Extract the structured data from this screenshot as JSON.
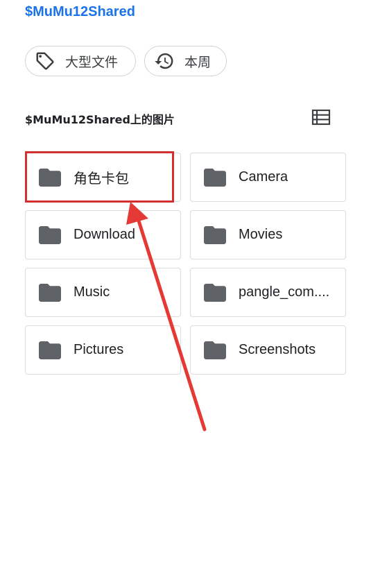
{
  "header": {
    "title": "$MuMu12Shared"
  },
  "filter_chips": [
    {
      "label": "大型文件",
      "icon": "tag-icon"
    },
    {
      "label": "本周",
      "icon": "history-icon"
    }
  ],
  "section": {
    "title": "$MuMu12Shared上的图片",
    "view_toggle_icon": "list-view-icon"
  },
  "folders": [
    {
      "label": "角色卡包",
      "highlighted": true
    },
    {
      "label": "Camera"
    },
    {
      "label": "Download"
    },
    {
      "label": "Movies"
    },
    {
      "label": "Music"
    },
    {
      "label": "pangle_com...."
    },
    {
      "label": "Pictures"
    },
    {
      "label": "Screenshots"
    }
  ],
  "colors": {
    "accent": "#1a73e8",
    "folder_icon": "#5f6368",
    "annotation": "#e53935"
  }
}
